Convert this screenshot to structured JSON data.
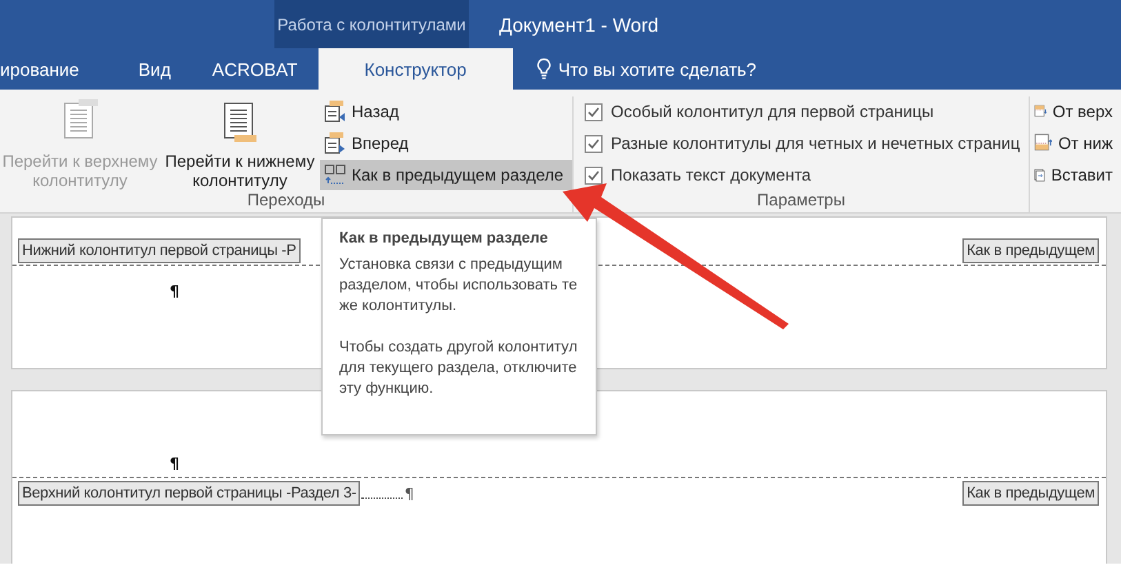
{
  "window": {
    "context_title": "Работа с колонтитулами",
    "title": "Документ1 - Word"
  },
  "tabs": [
    {
      "label": "ирование",
      "selected": false
    },
    {
      "label": "Вид",
      "selected": false
    },
    {
      "label": "ACROBAT",
      "selected": false
    },
    {
      "label": "Конструктор",
      "selected": true
    }
  ],
  "tell_me": {
    "placeholder": "Что вы хотите сделать?"
  },
  "ribbon": {
    "navigation": {
      "label": "Переходы",
      "large_buttons": [
        {
          "label": "Перейти к верхнему\nколонтитулу",
          "disabled": true
        },
        {
          "label": "Перейти к нижнему\nколонтитулу",
          "disabled": false
        }
      ],
      "small_buttons": [
        {
          "label": "Назад",
          "selected": false
        },
        {
          "label": "Вперед",
          "selected": false
        },
        {
          "label": "Как в предыдущем разделе",
          "selected": true
        }
      ]
    },
    "options": {
      "label": "Параметры",
      "checkboxes": [
        {
          "label": "Особый колонтитул для первой страницы",
          "checked": true
        },
        {
          "label": "Разные колонтитулы для четных и нечетных страниц",
          "checked": true
        },
        {
          "label": "Показать текст документа",
          "checked": true
        }
      ]
    },
    "position": {
      "small_buttons": [
        {
          "label": "От верх"
        },
        {
          "label": "От ниж"
        },
        {
          "label": "Вставит"
        }
      ]
    }
  },
  "document": {
    "pages": [
      {
        "kind": "footer",
        "label": "Нижний колонтитул первой страницы -Р",
        "link_label": "Как в предыдущем",
        "mark": "¶"
      },
      {
        "kind": "header",
        "mark": "¶",
        "label": "Верхний колонтитул первой страницы -Раздел 3-",
        "link_label": "Как в предыдущем",
        "end_mark": "¶"
      }
    ]
  },
  "tooltip": {
    "title": "Как в предыдущем разделе",
    "paragraphs": [
      "Установка связи с предыдущим разделом, чтобы использовать те же колонтитулы.",
      "Чтобы создать другой колонтитул для текущего раздела, отключите эту функцию."
    ]
  }
}
